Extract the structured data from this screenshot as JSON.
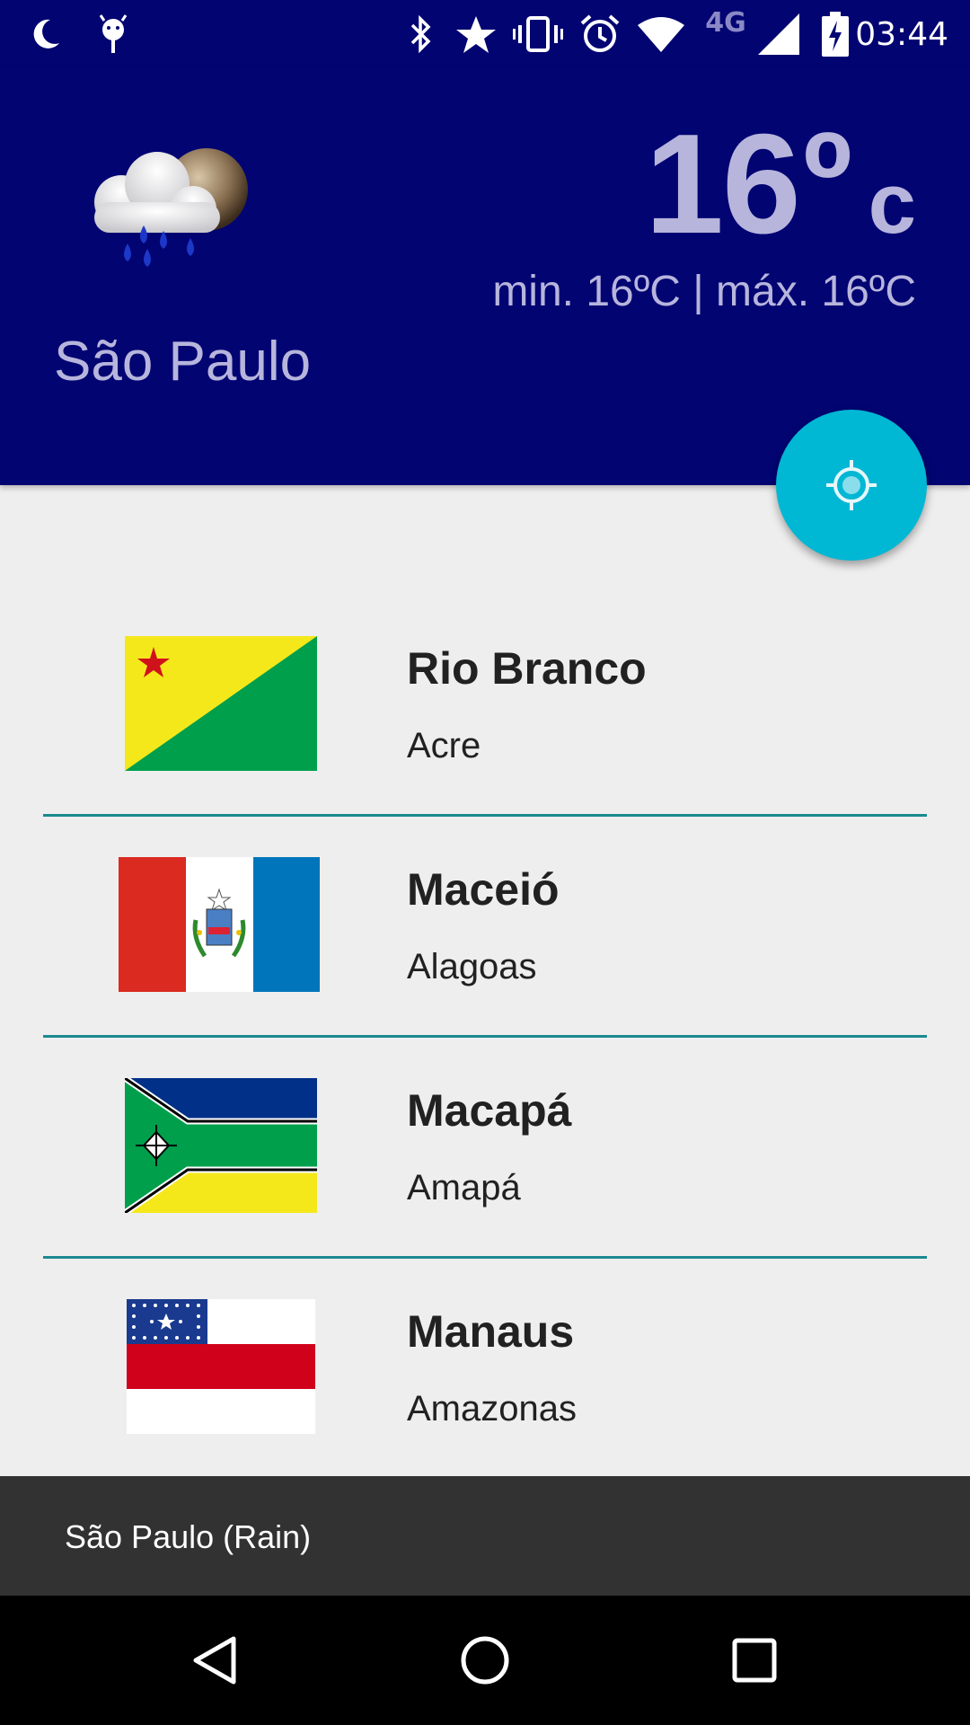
{
  "status_bar": {
    "time": "03:44",
    "network_type": "4G",
    "icons": [
      "night-mode-icon",
      "android-debug-icon",
      "bluetooth-icon",
      "star-icon",
      "vibrate-icon",
      "alarm-icon",
      "wifi-icon",
      "cellular-signal-icon",
      "battery-charging-icon"
    ]
  },
  "header": {
    "weather_icon": "rain-cloud-moon-icon",
    "temperature": "16",
    "degree_symbol": "º",
    "unit": "c",
    "min_max": "min. 16ºC | máx. 16ºC",
    "city": "São Paulo"
  },
  "fab": {
    "icon": "my-location-icon"
  },
  "cities": [
    {
      "name": "Rio Branco",
      "state": "Acre",
      "flag": "acre-flag"
    },
    {
      "name": "Maceió",
      "state": "Alagoas",
      "flag": "alagoas-flag"
    },
    {
      "name": "Macapá",
      "state": "Amapá",
      "flag": "amapa-flag"
    },
    {
      "name": "Manaus",
      "state": "Amazonas",
      "flag": "amazonas-flag"
    }
  ],
  "snackbar": {
    "text": "São Paulo (Rain)"
  },
  "nav_bar": {
    "icons": [
      "back-icon",
      "home-icon",
      "recents-icon"
    ]
  },
  "colors": {
    "header_bg": "#020472",
    "header_text": "#b7b5dc",
    "fab": "#00b7d4",
    "divider": "#1a8a8f",
    "list_bg": "#eeeeee",
    "snackbar_bg": "#323232"
  }
}
